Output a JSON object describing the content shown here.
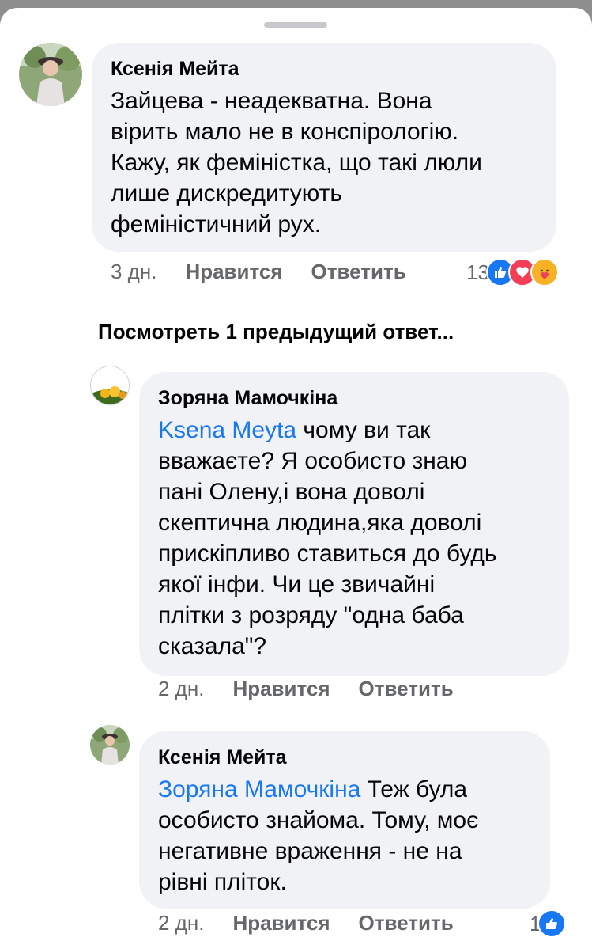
{
  "comments": [
    {
      "author": "Ксенія Мейта",
      "text": "Зайцева - неадекватна. Вона вірить мало не в конспірологію. Кажу, як феміністка, що такі люли лише дискредитують феміністичний рух.",
      "lines": [
        "Зайцева - неадекватна. Вона",
        "вірить мало не в конспірологію.",
        "Кажу, як феміністка, що такі люли",
        "лише дискредитують",
        "феміністичний рух."
      ],
      "time": "3 дн.",
      "like_label": "Нравится",
      "reply_label": "Ответить",
      "reaction_count": "13",
      "reaction_icons": [
        "like-icon",
        "love-icon",
        "care-icon"
      ]
    },
    {
      "author": "Зоряна Мамочкіна",
      "mention": "Ksena  Meyta",
      "lines": [
        " чому ви так",
        "вважаєте? Я особисто знаю",
        "пані Олену,і вона доволі",
        "скептична людина,яка доволі",
        "прискіпливо ставиться до будь",
        "якої інфи. Чи це звичайні",
        "плітки з розряду \"одна баба",
        "сказала\"?"
      ],
      "time": "2 дн.",
      "like_label": "Нравится",
      "reply_label": "Ответить"
    },
    {
      "author": "Ксенія Мейта",
      "mention": "Зоряна Мамочкіна",
      "lines": [
        " Теж була",
        "особисто знайома. Тому, моє",
        "негативне враження - не на",
        "рівні пліток."
      ],
      "time": "2 дн.",
      "like_label": "Нравится",
      "reply_label": "Ответить",
      "reaction_count": "1",
      "reaction_icons": [
        "like-icon"
      ]
    }
  ],
  "view_previous_replies": "Посмотреть 1 предыдущий ответ...",
  "colors": {
    "bubble": "#f0f2f5",
    "mention": "#1877f2",
    "meta": "#65676b",
    "like": "#1877f2",
    "love": "#f33e58"
  }
}
